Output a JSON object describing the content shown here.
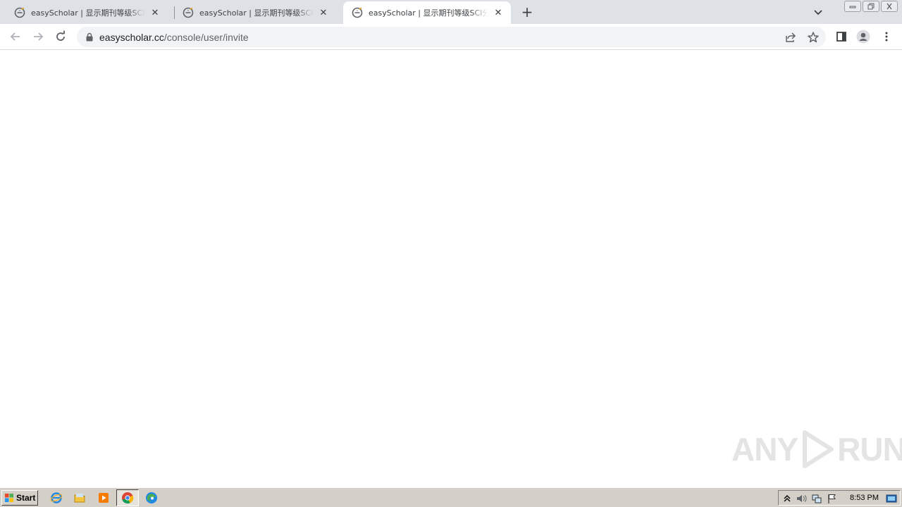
{
  "browser": {
    "tabs": [
      {
        "title": "easyScholar | 显示期刊等级SCI分区",
        "active": false
      },
      {
        "title": "easyScholar | 显示期刊等级SCI分区",
        "active": false
      },
      {
        "title": "easyScholar | 显示期刊等级SCI分区",
        "active": true
      }
    ],
    "close_glyph": "✕",
    "new_tab_glyph": "+",
    "omnibox": {
      "url_host": "easyscholar.cc",
      "url_path": "/console/user/invite"
    }
  },
  "watermark": {
    "left": "ANY",
    "right": "RUN"
  },
  "taskbar": {
    "start_label": "Start",
    "clock": "8:53 PM"
  },
  "colors": {
    "tabstrip": "#dee1e6",
    "taskbar": "#d4d0c8",
    "accent_blue": "#1a73e8"
  }
}
